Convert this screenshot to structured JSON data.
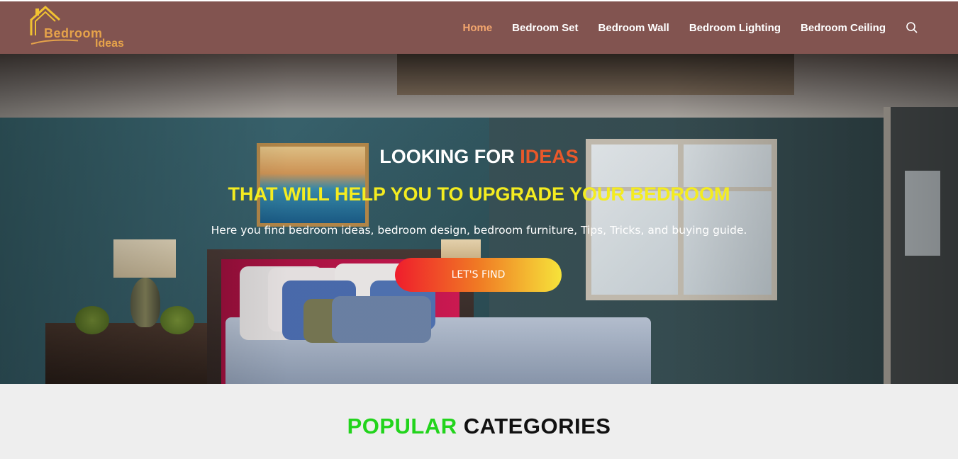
{
  "logo": {
    "line1": "Bedroom",
    "line2": "Ideas"
  },
  "nav": {
    "items": [
      {
        "label": "Home",
        "active": true
      },
      {
        "label": "Bedroom Set",
        "active": false
      },
      {
        "label": "Bedroom Wall",
        "active": false
      },
      {
        "label": "Bedroom Lighting",
        "active": false
      },
      {
        "label": "Bedroom Ceiling",
        "active": false
      }
    ],
    "search_icon": "search-icon"
  },
  "hero": {
    "heading_prefix": "LOOKING FOR ",
    "heading_accent": "IDEAS",
    "subheading": "THAT WILL HELP YOU TO UPGRADE YOUR BEDROOM",
    "description": "Here you find bedroom ideas, bedroom design, bedroom furniture, Tips, Tricks, and buying guide.",
    "cta_label": "LET'S FIND"
  },
  "categories": {
    "title_accent": "POPULAR",
    "title_rest": " CATEGORIES"
  },
  "colors": {
    "header_bg": "#825450",
    "nav_active": "#f3a66e",
    "heading_accent": "#e9582a",
    "subheading": "#f4ec20",
    "categories_accent": "#22d41c"
  }
}
